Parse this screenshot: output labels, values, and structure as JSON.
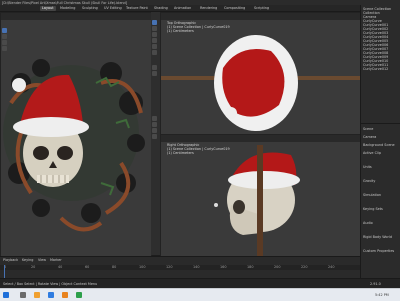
{
  "window": {
    "title": "[D:\\Blender Files\\Pixel Art\\Xmas\\Full Christmas Skull (Skull For Life).blend]"
  },
  "menu": {
    "items": [
      "Layout",
      "Modeling",
      "Sculpting",
      "UV Editing",
      "Texture Paint",
      "Shading",
      "Animation",
      "Rendering",
      "Compositing",
      "Scripting"
    ]
  },
  "viewports": [
    {
      "name": "User Perspective",
      "line2": "(1) Scene Collection | CurlyCurve021"
    },
    {
      "name": "Top Orthographic",
      "line2": "(1) Scene Collection | CurlyCurve019",
      "line3": "(1) Centimeters"
    },
    {
      "name": "Right Orthographic",
      "line2": "(1) Scene Collection | CurlyCurve019",
      "line3": "(1) Centimeters"
    }
  ],
  "timeline": {
    "ticks": [
      "0",
      "20",
      "40",
      "60",
      "80",
      "100",
      "120",
      "140",
      "160",
      "180",
      "200",
      "220",
      "240"
    ],
    "playback": "Playback",
    "keying": "Keying",
    "view": "View",
    "marker": "Marker"
  },
  "outliner": {
    "items": [
      "Scene Collection",
      "Collection",
      "Camera",
      "CurlyCurve",
      "CurlyCurve001",
      "CurlyCurve002",
      "CurlyCurve003",
      "CurlyCurve004",
      "CurlyCurve005",
      "CurlyCurve006",
      "CurlyCurve007",
      "CurlyCurve008",
      "CurlyCurve009",
      "CurlyCurve010",
      "CurlyCurve011",
      "CurlyCurve012"
    ]
  },
  "properties": {
    "rows": [
      "Scene",
      "Camera",
      "Background Scene",
      "Active Clip",
      "Units",
      "Gravity",
      "Simulation",
      "Keying Sets",
      "Audio",
      "Rigid Body World",
      "Custom Properties"
    ]
  },
  "status": {
    "text": "Select / Box Select  |  Rotate View  |  Object Context Menu",
    "version": "2.91.0"
  },
  "taskbar": {
    "time": "5:42 PM"
  }
}
